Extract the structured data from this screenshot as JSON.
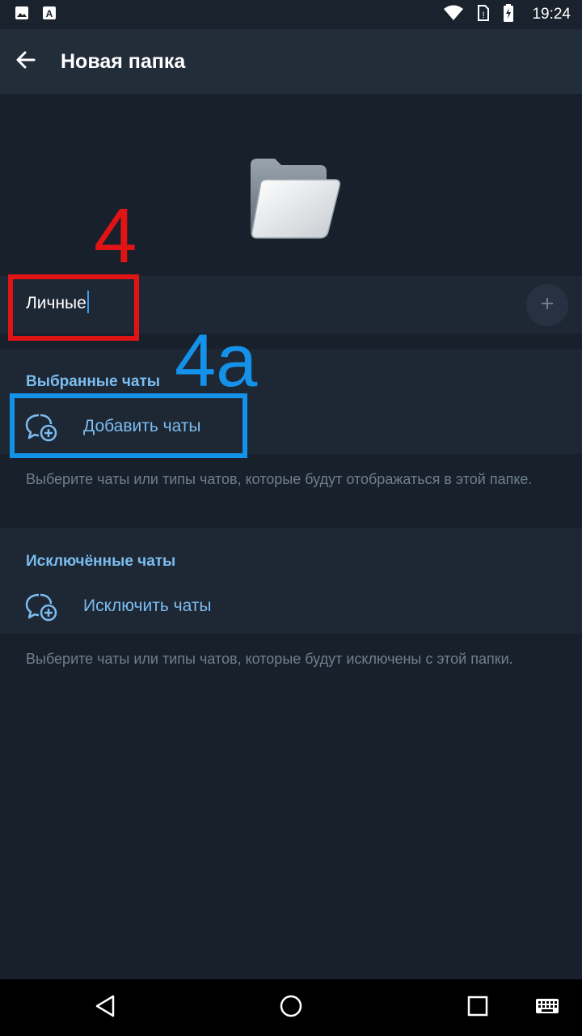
{
  "status_bar": {
    "time": "19:24",
    "icons": [
      "image-icon",
      "keyboard-a-icon",
      "wifi-icon",
      "no-sim-icon",
      "battery-charging-icon"
    ]
  },
  "app_bar": {
    "back_icon": "arrow-left-icon",
    "title": "Новая папка"
  },
  "folder_icon": "folder-icon",
  "name_field": {
    "value": "Личные",
    "emoji_button_icon": "plus-icon"
  },
  "included": {
    "header": "Выбранные чаты",
    "action_label": "Добавить чаты",
    "action_icon": "chat-add-icon",
    "hint": "Выберите чаты или типы чатов, которые будут отображаться в этой папке."
  },
  "excluded": {
    "header": "Исключённые чаты",
    "action_label": "Исключить чаты",
    "action_icon": "chat-add-icon",
    "hint": "Выберите чаты или типы чатов, которые будут исключены с этой папки."
  },
  "annotations": {
    "red_label": "4",
    "blue_label": "4a",
    "red_color": "#e01414",
    "blue_color": "#1492ea"
  },
  "colors": {
    "background": "#18202b",
    "app_bar": "#222d3a",
    "section": "#1e2835",
    "accent": "#7cbdf0",
    "hint": "#6f7f8f"
  },
  "nav_bar": {
    "icons": [
      "back-triangle-icon",
      "home-circle-icon",
      "recents-square-icon",
      "keyboard-icon"
    ]
  }
}
